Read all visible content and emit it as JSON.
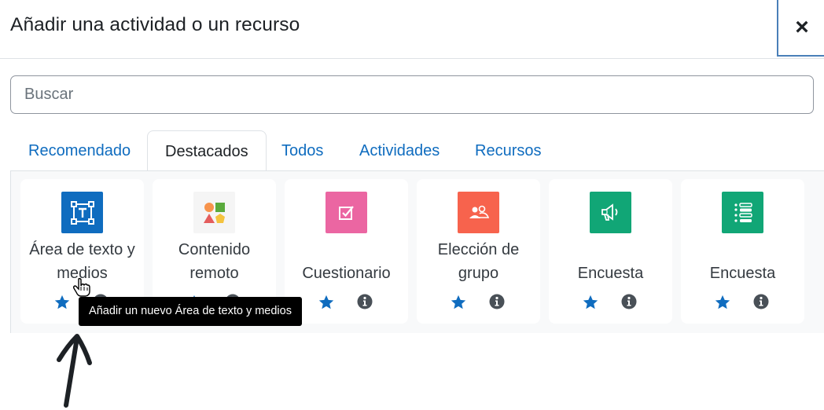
{
  "modal": {
    "title": "Añadir una actividad o un recurso",
    "close_glyph": "×"
  },
  "search": {
    "placeholder": "Buscar",
    "value": ""
  },
  "tabs": [
    {
      "label": "Recomendado",
      "active": false
    },
    {
      "label": "Destacados",
      "active": true
    },
    {
      "label": "Todos",
      "active": false
    },
    {
      "label": "Actividades",
      "active": false
    },
    {
      "label": "Recursos",
      "active": false
    }
  ],
  "cards": [
    {
      "line1": "Área de texto y",
      "line2": "medios",
      "icon": "text-area-icon",
      "color": "#0f6cbf"
    },
    {
      "line1": "Contenido",
      "line2": "remoto",
      "icon": "shapes-icon",
      "color": "#f5f5f5"
    },
    {
      "line1": "Cuestionario",
      "line2": "",
      "icon": "checkbox-icon",
      "color": "#eb66a2"
    },
    {
      "line1": "Elección de",
      "line2": "grupo",
      "icon": "group-icon",
      "color": "#f7634d"
    },
    {
      "line1": "Encuesta",
      "line2": "",
      "icon": "megaphone-icon",
      "color": "#11a676"
    },
    {
      "line1": "Encuesta",
      "line2": "",
      "icon": "list-icon",
      "color": "#11a676"
    }
  ],
  "tooltip": {
    "text": "Añadir un nuevo Área de texto y medios"
  },
  "colors": {
    "link": "#0f6cbf",
    "star": "#0f6cbf",
    "info": "#495057"
  }
}
